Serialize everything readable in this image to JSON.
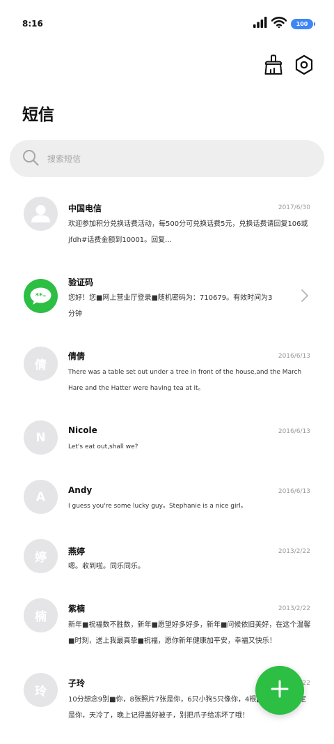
{
  "status_bar": {
    "time": "8:16",
    "battery": "100",
    "icons": [
      "signal-icon",
      "wifi-icon",
      "battery-icon"
    ]
  },
  "header": {
    "title": "短信",
    "actions": [
      "clean-brush-icon",
      "settings-hexagon-icon"
    ]
  },
  "search": {
    "placeholder": "搜索短信"
  },
  "messages": [
    {
      "sender": "中国电信",
      "date": "2017/6/30",
      "preview": "欢迎参加积分兑换话费活动，每500分可兑换话费5元，兑换话费请回复106或jfdh#话费金额到10001。回复...",
      "avatar": "",
      "avatar_icon": "person-icon"
    },
    {
      "sender": "验证码",
      "date": "",
      "preview": "您好！您■网上营业厅登录■随机密码为：710679。有效时间为3分钟",
      "avatar": "",
      "avatar_icon": "message-code-icon"
    },
    {
      "sender": "倩倩",
      "date": "2016/6/13",
      "preview": "There was a table set out under a tree in front of the house,and the March Hare and the Hatter were having tea at it。",
      "avatar": "倩"
    },
    {
      "sender": "Nicole",
      "date": "2016/6/13",
      "preview": "Let's eat out,shall we?",
      "avatar": "N"
    },
    {
      "sender": "Andy",
      "date": "2016/6/13",
      "preview": "I guess you're some lucky guy。Stephanie is a nice girl。",
      "avatar": "A"
    },
    {
      "sender": "燕婷",
      "date": "2013/2/22",
      "preview": "嗯。收到啦。同乐同乐。",
      "avatar": "婷"
    },
    {
      "sender": "紫楠",
      "date": "2013/2/22",
      "preview": "新年■祝福数不胜数，新年■愿望好多好多，新年■问候依旧美好，在这个温馨■时刻，送上我最真挚■祝福，愿你新年健康加平安，幸福又快乐！",
      "avatar": "楠"
    },
    {
      "sender": "子玲",
      "date": "2013/2/22",
      "preview": "10分想念9别■你，8张照片7张是你，6只小狗5只像你，4根■■2爪着地1定是你，天冷了，晚上记得盖好被子，别把爪子给冻坏了哦！",
      "avatar": "玲"
    }
  ],
  "fab": {
    "icon": "plus-icon"
  },
  "colors": {
    "accent_green": "#2dbe44",
    "battery_blue": "#3d86f5",
    "avatar_gray": "#e5e5e7",
    "search_bg": "#eeeeee"
  }
}
